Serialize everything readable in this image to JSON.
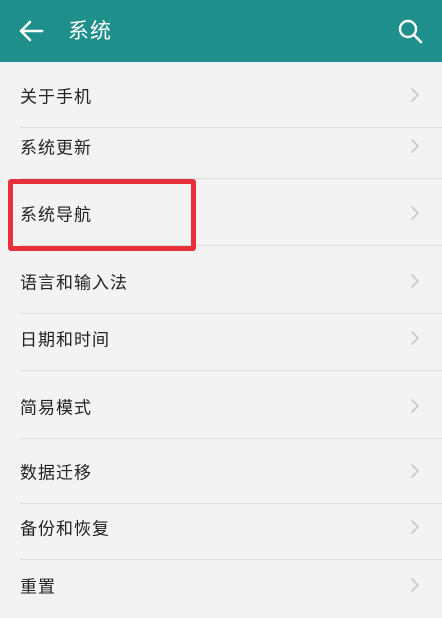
{
  "appbar": {
    "title": "系统",
    "back_icon": "arrow-left-icon",
    "search_icon": "search-icon",
    "background_color": "#1f8f8b"
  },
  "menu": {
    "items": [
      {
        "label": "关于手机"
      },
      {
        "label": "系统更新"
      },
      {
        "label": "系统导航"
      },
      {
        "label": "语言和输入法"
      },
      {
        "label": "日期和时间"
      },
      {
        "label": "简易模式"
      },
      {
        "label": "数据迁移"
      },
      {
        "label": "备份和恢复"
      },
      {
        "label": "重置"
      }
    ]
  },
  "annotation": {
    "highlighted_item": "系统导航",
    "color": "#e8303a"
  }
}
